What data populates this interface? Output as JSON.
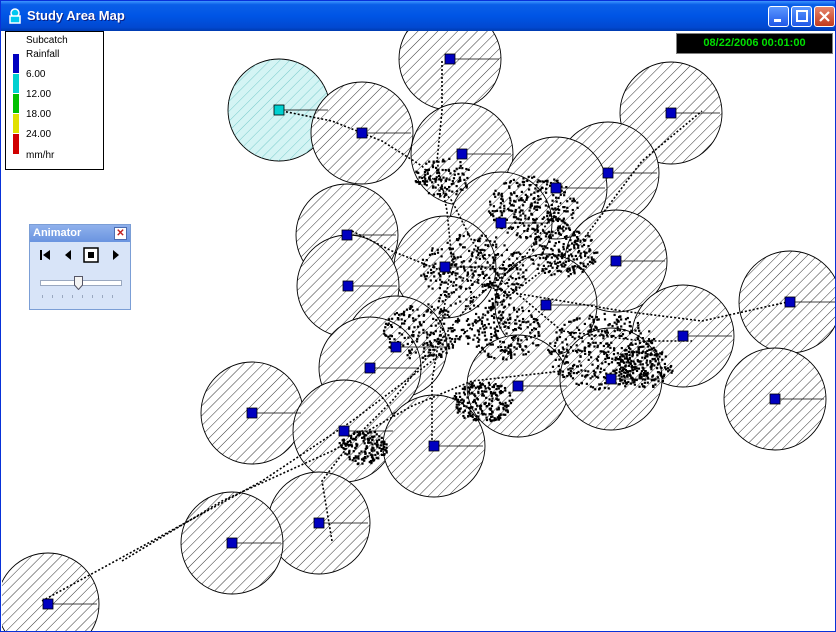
{
  "window": {
    "title": "Study Area Map",
    "colors": {
      "titlebar": "#0055e5",
      "close_button": "#c23b1e"
    }
  },
  "legend": {
    "layer": "Subcatch",
    "variable": "Rainfall",
    "levels": [
      "6.00",
      "12.00",
      "18.00",
      "24.00"
    ],
    "unit": "mm/hr",
    "colors": [
      "#0000c0",
      "#00d0d0",
      "#00c000",
      "#e0e000",
      "#d00000"
    ]
  },
  "datetime": "08/22/2006 00:01:00",
  "animator": {
    "title": "Animator",
    "buttons": [
      "rewind-icon",
      "back-icon",
      "stop-icon",
      "forward-icon"
    ],
    "speed_fraction": 0.5
  },
  "map": {
    "subcatchment_fill": "#0000c0",
    "highlight_fill": "#00d0d0"
  }
}
